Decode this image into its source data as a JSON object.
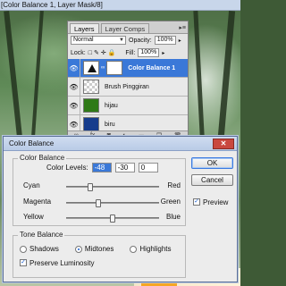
{
  "window": {
    "title": "[Color Balance 1, Layer Mask/8]"
  },
  "layers_panel": {
    "tabs": [
      {
        "label": "Layers"
      },
      {
        "label": "Layer Comps"
      }
    ],
    "blend_mode": "Normal",
    "opacity_label": "Opacity:",
    "opacity_value": "100%",
    "lock_label": "Lock:",
    "fill_label": "Fill:",
    "fill_value": "100%",
    "layers": [
      {
        "name": "Color Balance 1",
        "thumb": "adjustment-thumbnail",
        "selected": true
      },
      {
        "name": "Brush Pinggiran",
        "thumb": "transparent-thumbnail",
        "selected": false
      },
      {
        "name": "hijau",
        "thumb": "green-thumbnail",
        "selected": false
      },
      {
        "name": "biru",
        "thumb": "blue-thumbnail",
        "selected": false
      }
    ]
  },
  "dialog": {
    "title": "Color Balance",
    "color_balance_group": "Color Balance",
    "color_levels_label": "Color Levels:",
    "levels": [
      "-48",
      "-30",
      "0"
    ],
    "sliders": [
      {
        "left": "Cyan",
        "right": "Red",
        "value": -48
      },
      {
        "left": "Magenta",
        "right": "Green",
        "value": -30
      },
      {
        "left": "Yellow",
        "right": "Blue",
        "value": 0
      }
    ],
    "tone_group": "Tone Balance",
    "tone_options": [
      {
        "label": "Shadows",
        "selected": false
      },
      {
        "label": "Midtones",
        "selected": true
      },
      {
        "label": "Highlights",
        "selected": false
      }
    ],
    "preserve_luminosity": "Preserve Luminosity",
    "ok_label": "OK",
    "cancel_label": "Cancel",
    "preview_label": "Preview"
  }
}
